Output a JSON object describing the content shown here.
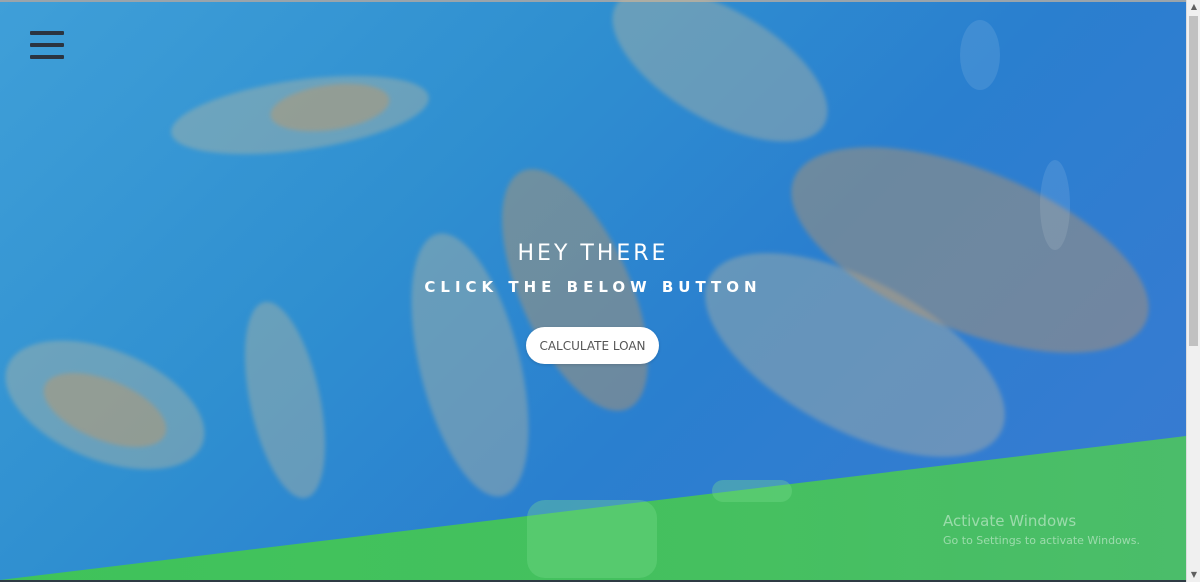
{
  "hero": {
    "title": "HEY THERE",
    "subtitle": "CLICK THE BELOW BUTTON",
    "cta_label": "CALCULATE LOAN"
  },
  "menu": {
    "icon": "hamburger-menu-icon"
  },
  "watermark": {
    "title": "Activate Windows",
    "subtitle": "Go to Settings to activate Windows."
  },
  "scrollbar": {
    "up_icon": "scroll-up-arrow-icon",
    "down_icon": "scroll-down-arrow-icon"
  },
  "colors": {
    "water_blue": "#2f8fd0",
    "green_section": "#42c05c",
    "menu_icon": "#2b3440",
    "button_bg": "#ffffff",
    "button_text": "#555555"
  }
}
